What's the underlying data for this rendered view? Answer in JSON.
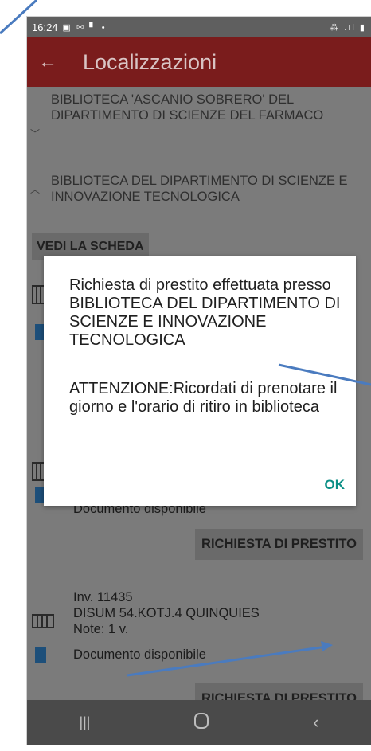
{
  "status_bar": {
    "time": "16:24",
    "left_icons": "▣ ✉ ▘ •",
    "right_icons": "⁂ .ıl ▮"
  },
  "app_bar": {
    "back_icon": "arrow-left",
    "title": "Localizzazioni"
  },
  "libraries": [
    {
      "name": "BIBLIOTECA 'ASCANIO SOBRERO' DEL DIPARTIMENTO DI SCIENZE DEL FARMACO",
      "expanded": false
    },
    {
      "name": "BIBLIOTECA DEL DIPARTIMENTO DI SCIENZE E INNOVAZIONE TECNOLOGICA",
      "expanded": true
    }
  ],
  "detail_button": "VEDI LA SCHEDA",
  "items": [
    {
      "availability": "Documento disponibile",
      "request_button": "RICHIESTA DI PRESTITO"
    },
    {
      "inventory": "Inv. 11435",
      "shelfmark": "DISUM 54.KOTJ.4 QUINQUIES",
      "note": "Note: 1 v.",
      "availability": "Documento disponibile",
      "request_button": "RICHIESTA DI PRESTITO"
    }
  ],
  "dialog": {
    "message": "Richiesta di prestito effettuata presso BIBLIOTECA DEL DIPARTIMENTO DI SCIENZE E INNOVAZIONE TECNOLOGICA",
    "warning": "ATTENZIONE:Ricordati di prenotare il giorno e l'orario di ritiro in biblioteca",
    "ok_label": "OK"
  },
  "colors": {
    "app_bar": "#7a1c1c",
    "dialog_button": "#0b8f86",
    "annotation_arrow": "#4a7bbf",
    "document_icon": "#1d4f7a"
  }
}
